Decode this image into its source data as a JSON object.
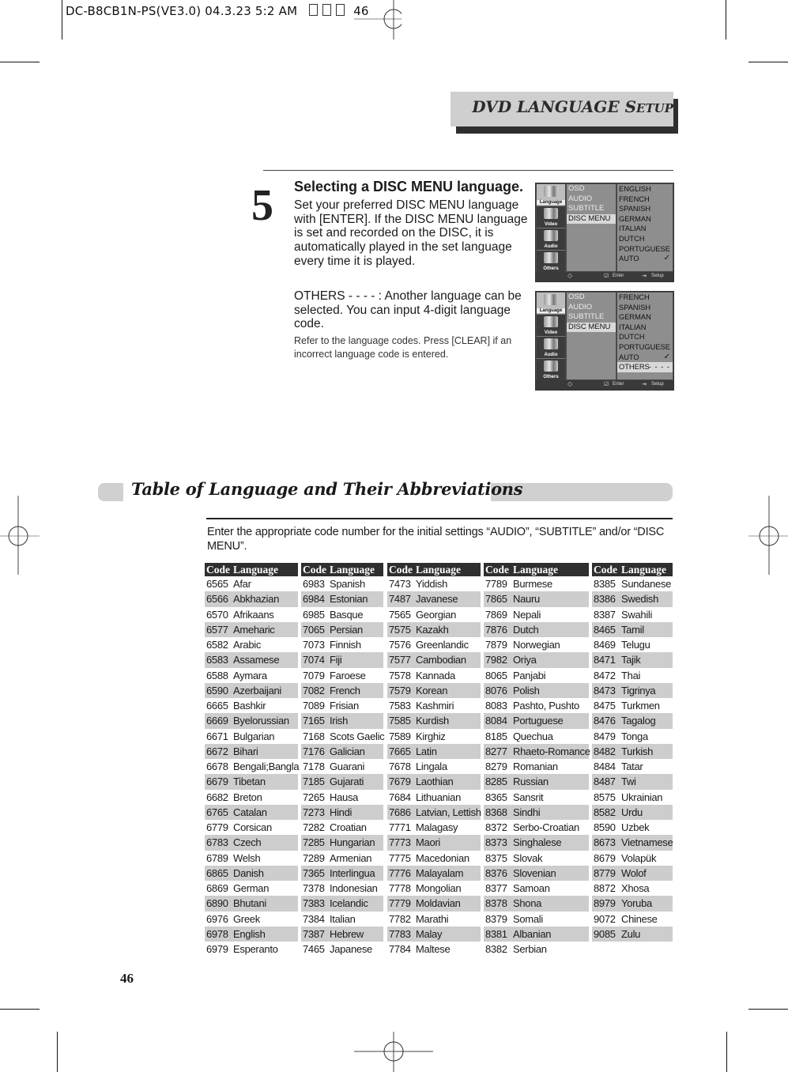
{
  "slug": {
    "text": "DC-B8CB1N-PS(VE3.0)  04.3.23 5:2 AM",
    "page_ref": "46"
  },
  "section": {
    "title_main": "DVD LANGUAGE S",
    "title_small": "ETUP"
  },
  "step": {
    "number": "5",
    "heading": "Selecting a DISC MENU language.",
    "body": "Set your preferred DISC MENU language with [ENTER]. If the DISC MENU language is set and recorded on the DISC, it is automatically played in the set language every time it is played.",
    "others": "OTHERS - - - - : Another language can be selected. You can input 4-digit language code.",
    "note": "Refer to the language codes. Press [CLEAR] if an incorrect language code is entered."
  },
  "osd_menus": [
    {
      "tabs": [
        "Language",
        "Video",
        "Audio",
        "Others"
      ],
      "active_tab": "Language",
      "items": [
        "OSD",
        "AUDIO",
        "SUBTITLE",
        "DISC MENU"
      ],
      "selected_item": "DISC MENU",
      "options": [
        "ENGLISH",
        "FRENCH",
        "SPANISH",
        "GERMAN",
        "ITALIAN",
        "DUTCH",
        "PORTUGUESE",
        "AUTO"
      ],
      "checked_option": "AUTO",
      "footer": {
        "enter": "Enter",
        "setup": "Setup"
      }
    },
    {
      "tabs": [
        "Language",
        "Video",
        "Audio",
        "Others"
      ],
      "active_tab": "Language",
      "items": [
        "OSD",
        "AUDIO",
        "SUBTITLE",
        "DISC MENU"
      ],
      "selected_item": "DISC MENU",
      "options": [
        "FRENCH",
        "SPANISH",
        "GERMAN",
        "ITALIAN",
        "DUTCH",
        "PORTUGUESE",
        "AUTO",
        "OTHERS"
      ],
      "checked_option": "AUTO",
      "highlighted_option": "OTHERS",
      "others_code": "- - - -",
      "footer": {
        "enter": "Enter",
        "setup": "Setup"
      }
    }
  ],
  "table": {
    "title": "Table of Language and Their Abbreviations",
    "intro": "Enter the appropriate code number for the initial settings “AUDIO”, “SUBTITLE” and/or “DISC MENU”.",
    "header": {
      "code": "Code",
      "language": "Language"
    },
    "columns": [
      [
        [
          "6565",
          "Afar"
        ],
        [
          "6566",
          "Abkhazian"
        ],
        [
          "6570",
          "Afrikaans"
        ],
        [
          "6577",
          "Ameharic"
        ],
        [
          "6582",
          "Arabic"
        ],
        [
          "6583",
          "Assamese"
        ],
        [
          "6588",
          "Aymara"
        ],
        [
          "6590",
          "Azerbaijani"
        ],
        [
          "6665",
          "Bashkir"
        ],
        [
          "6669",
          "Byelorussian"
        ],
        [
          "6671",
          "Bulgarian"
        ],
        [
          "6672",
          "Bihari"
        ],
        [
          "6678",
          "Bengali;Bangla"
        ],
        [
          "6679",
          "Tibetan"
        ],
        [
          "6682",
          "Breton"
        ],
        [
          "6765",
          "Catalan"
        ],
        [
          "6779",
          "Corsican"
        ],
        [
          "6783",
          "Czech"
        ],
        [
          "6789",
          "Welsh"
        ],
        [
          "6865",
          "Danish"
        ],
        [
          "6869",
          "German"
        ],
        [
          "6890",
          "Bhutani"
        ],
        [
          "6976",
          "Greek"
        ],
        [
          "6978",
          "English"
        ],
        [
          "6979",
          "Esperanto"
        ]
      ],
      [
        [
          "6983",
          "Spanish"
        ],
        [
          "6984",
          "Estonian"
        ],
        [
          "6985",
          "Basque"
        ],
        [
          "7065",
          "Persian"
        ],
        [
          "7073",
          "Finnish"
        ],
        [
          "7074",
          "Fiji"
        ],
        [
          "7079",
          "Faroese"
        ],
        [
          "7082",
          "French"
        ],
        [
          "7089",
          "Frisian"
        ],
        [
          "7165",
          "Irish"
        ],
        [
          "7168",
          "Scots Gaelic"
        ],
        [
          "7176",
          "Galician"
        ],
        [
          "7178",
          "Guarani"
        ],
        [
          "7185",
          "Gujarati"
        ],
        [
          "7265",
          "Hausa"
        ],
        [
          "7273",
          "Hindi"
        ],
        [
          "7282",
          "Croatian"
        ],
        [
          "7285",
          "Hungarian"
        ],
        [
          "7289",
          "Armenian"
        ],
        [
          "7365",
          "Interlingua"
        ],
        [
          "7378",
          "Indonesian"
        ],
        [
          "7383",
          "Icelandic"
        ],
        [
          "7384",
          "Italian"
        ],
        [
          "7387",
          "Hebrew"
        ],
        [
          "7465",
          "Japanese"
        ]
      ],
      [
        [
          "7473",
          "Yiddish"
        ],
        [
          "7487",
          "Javanese"
        ],
        [
          "7565",
          "Georgian"
        ],
        [
          "7575",
          "Kazakh"
        ],
        [
          "7576",
          "Greenlandic"
        ],
        [
          "7577",
          "Cambodian"
        ],
        [
          "7578",
          "Kannada"
        ],
        [
          "7579",
          "Korean"
        ],
        [
          "7583",
          "Kashmiri"
        ],
        [
          "7585",
          "Kurdish"
        ],
        [
          "7589",
          "Kirghiz"
        ],
        [
          "7665",
          "Latin"
        ],
        [
          "7678",
          "Lingala"
        ],
        [
          "7679",
          "Laothian"
        ],
        [
          "7684",
          "Lithuanian"
        ],
        [
          "7686",
          "Latvian, Lettish"
        ],
        [
          "7771",
          "Malagasy"
        ],
        [
          "7773",
          "Maori"
        ],
        [
          "7775",
          "Macedonian"
        ],
        [
          "7776",
          "Malayalam"
        ],
        [
          "7778",
          "Mongolian"
        ],
        [
          "7779",
          "Moldavian"
        ],
        [
          "7782",
          "Marathi"
        ],
        [
          "7783",
          "Malay"
        ],
        [
          "7784",
          "Maltese"
        ]
      ],
      [
        [
          "7789",
          "Burmese"
        ],
        [
          "7865",
          "Nauru"
        ],
        [
          "7869",
          "Nepali"
        ],
        [
          "7876",
          "Dutch"
        ],
        [
          "7879",
          "Norwegian"
        ],
        [
          "7982",
          "Oriya"
        ],
        [
          "8065",
          "Panjabi"
        ],
        [
          "8076",
          "Polish"
        ],
        [
          "8083",
          "Pashto, Pushto"
        ],
        [
          "8084",
          "Portuguese"
        ],
        [
          "8185",
          "Quechua"
        ],
        [
          "8277",
          "Rhaeto-Romance"
        ],
        [
          "8279",
          "Romanian"
        ],
        [
          "8285",
          "Russian"
        ],
        [
          "8365",
          "Sansrit"
        ],
        [
          "8368",
          "Sindhi"
        ],
        [
          "8372",
          "Serbo-Croatian"
        ],
        [
          "8373",
          "Singhalese"
        ],
        [
          "8375",
          "Slovak"
        ],
        [
          "8376",
          "Slovenian"
        ],
        [
          "8377",
          "Samoan"
        ],
        [
          "8378",
          "Shona"
        ],
        [
          "8379",
          "Somali"
        ],
        [
          "8381",
          "Albanian"
        ],
        [
          "8382",
          "Serbian"
        ]
      ],
      [
        [
          "8385",
          "Sundanese"
        ],
        [
          "8386",
          "Swedish"
        ],
        [
          "8387",
          "Swahili"
        ],
        [
          "8465",
          "Tamil"
        ],
        [
          "8469",
          "Telugu"
        ],
        [
          "8471",
          "Tajik"
        ],
        [
          "8472",
          "Thai"
        ],
        [
          "8473",
          "Tigrinya"
        ],
        [
          "8475",
          "Turkmen"
        ],
        [
          "8476",
          "Tagalog"
        ],
        [
          "8479",
          "Tonga"
        ],
        [
          "8482",
          "Turkish"
        ],
        [
          "8484",
          "Tatar"
        ],
        [
          "8487",
          "Twi"
        ],
        [
          "8575",
          "Ukrainian"
        ],
        [
          "8582",
          "Urdu"
        ],
        [
          "8590",
          "Uzbek"
        ],
        [
          "8673",
          "Vietnamese"
        ],
        [
          "8679",
          "Volapük"
        ],
        [
          "8779",
          "Wolof"
        ],
        [
          "8872",
          "Xhosa"
        ],
        [
          "8979",
          "Yoruba"
        ],
        [
          "9072",
          "Chinese"
        ],
        [
          "9085",
          "Zulu"
        ]
      ]
    ]
  },
  "page_number": "46"
}
